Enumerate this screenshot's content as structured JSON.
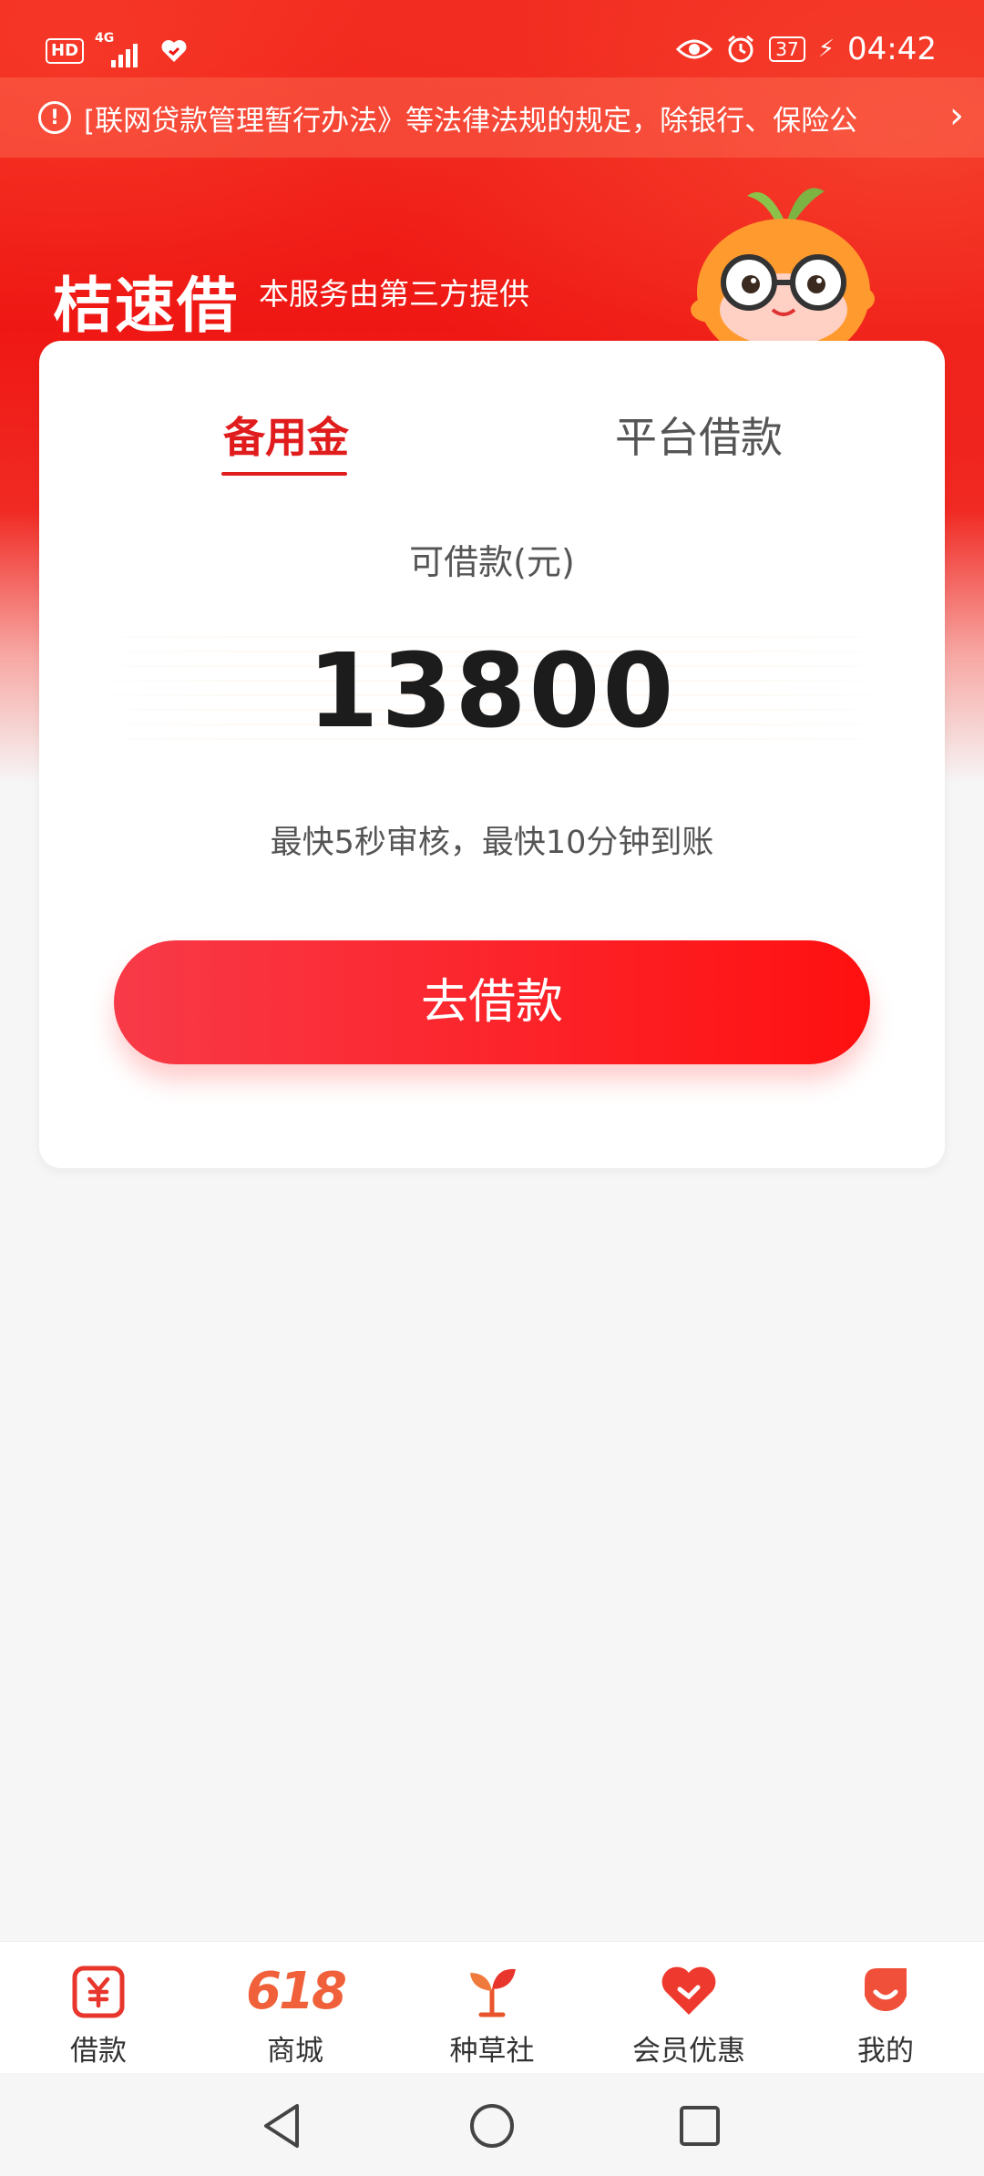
{
  "status_bar": {
    "hd": "HD",
    "network": "4G",
    "battery": "37",
    "time": "04:42"
  },
  "notice": {
    "text": "《互联网贷款管理暂行办法》等法律法规的规定，除银行、保险公司外",
    "display_text": "[联网贷款管理暂行办法》等法律法规的规定，除银行、保险公"
  },
  "header": {
    "brand": "桔速借",
    "subtitle": "本服务由第三方提供"
  },
  "card": {
    "tabs": [
      {
        "label": "备用金",
        "active": true
      },
      {
        "label": "平台借款",
        "active": false
      }
    ],
    "available_label": "可借款(元)",
    "amount": "13800",
    "speed_note": "最快5秒审核，最快10分钟到账",
    "cta_label": "去借款"
  },
  "tabbar": {
    "items": [
      {
        "label": "借款",
        "icon": "yuan-icon",
        "active": true
      },
      {
        "label": "商城",
        "icon": "618-icon",
        "icon_text": "618"
      },
      {
        "label": "种草社",
        "icon": "sprout-icon"
      },
      {
        "label": "会员优惠",
        "icon": "member-heart-icon"
      },
      {
        "label": "我的",
        "icon": "profile-icon"
      }
    ]
  },
  "colors": {
    "brand_red": "#e01c1c",
    "button_start": "#f83a48",
    "button_end": "#ff1010"
  }
}
